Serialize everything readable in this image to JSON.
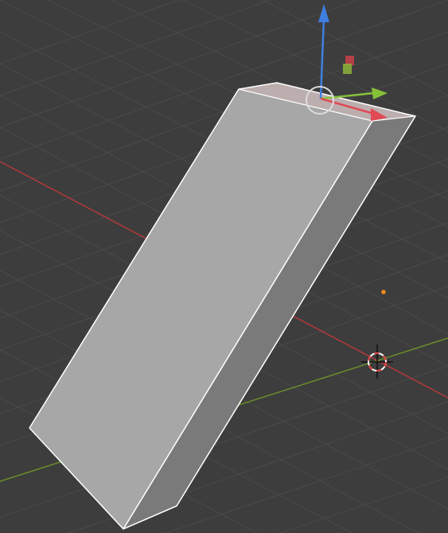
{
  "viewport": {
    "background": "#3d3d3d",
    "grid_color": "#4a4a4a",
    "x_axis_color": "#b03a3a",
    "y_axis_color": "#6a8e2a"
  },
  "object": {
    "type": "box",
    "selected": true,
    "front_face_color": "#a7a7a7",
    "side_face_color": "#7a7a7a",
    "top_face_color": "#bcaeae",
    "outline_color": "#ffffff"
  },
  "gizmo": {
    "z_arrow_color": "#3f7fe0",
    "x_arrow_color": "#e04a55",
    "y_arrow_color": "#86c13a",
    "plane_handle_colors": [
      "#c9414a",
      "#8fb33a"
    ],
    "rotate_ring_color": "#dddddd"
  },
  "cursor_3d": {
    "ring_colors": [
      "#e03d3d",
      "#ffffff"
    ],
    "crosshair_color": "#111111"
  },
  "origin_dot_color": "#f08a1a"
}
